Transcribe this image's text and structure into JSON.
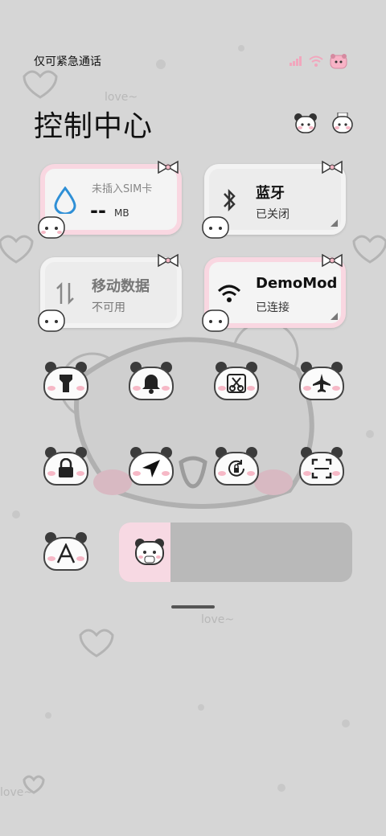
{
  "status": {
    "carrier_text": "仅可紧急通话",
    "icons": [
      "signal-icon",
      "wifi-icon",
      "battery-bear-icon"
    ]
  },
  "header": {
    "title": "控制中心"
  },
  "tiles": {
    "sim": {
      "label": "未插入SIM卡",
      "value": "--",
      "unit": "MB",
      "icon": "water-drop-icon"
    },
    "bluetooth": {
      "label": "蓝牙",
      "status": "已关闭",
      "icon": "bluetooth-icon"
    },
    "mobile_data": {
      "label": "移动数据",
      "status": "不可用",
      "icon": "data-arrows-icon"
    },
    "wifi": {
      "label": "DemoMod",
      "status": "已连接",
      "icon": "wifi-icon"
    }
  },
  "toggles": [
    {
      "name": "flashlight",
      "icon": "flashlight-icon"
    },
    {
      "name": "mute",
      "icon": "bell-icon"
    },
    {
      "name": "screenshot",
      "icon": "scissors-icon"
    },
    {
      "name": "airplane",
      "icon": "airplane-icon"
    },
    {
      "name": "lock-screen",
      "icon": "lock-icon"
    },
    {
      "name": "location",
      "icon": "location-arrow-icon"
    },
    {
      "name": "rotation-lock",
      "icon": "rotation-lock-icon"
    },
    {
      "name": "scanner",
      "icon": "scan-icon"
    },
    {
      "name": "font",
      "icon": "font-a-icon"
    }
  ],
  "brightness": {
    "level": 0.22,
    "thumb_icon": "bear-brightness-icon"
  },
  "colors": {
    "background": "#d6d6d6",
    "accent_pink": "#f7d9e3",
    "tile_bg": "#ececec",
    "slider_bg": "#b9b9b9"
  }
}
